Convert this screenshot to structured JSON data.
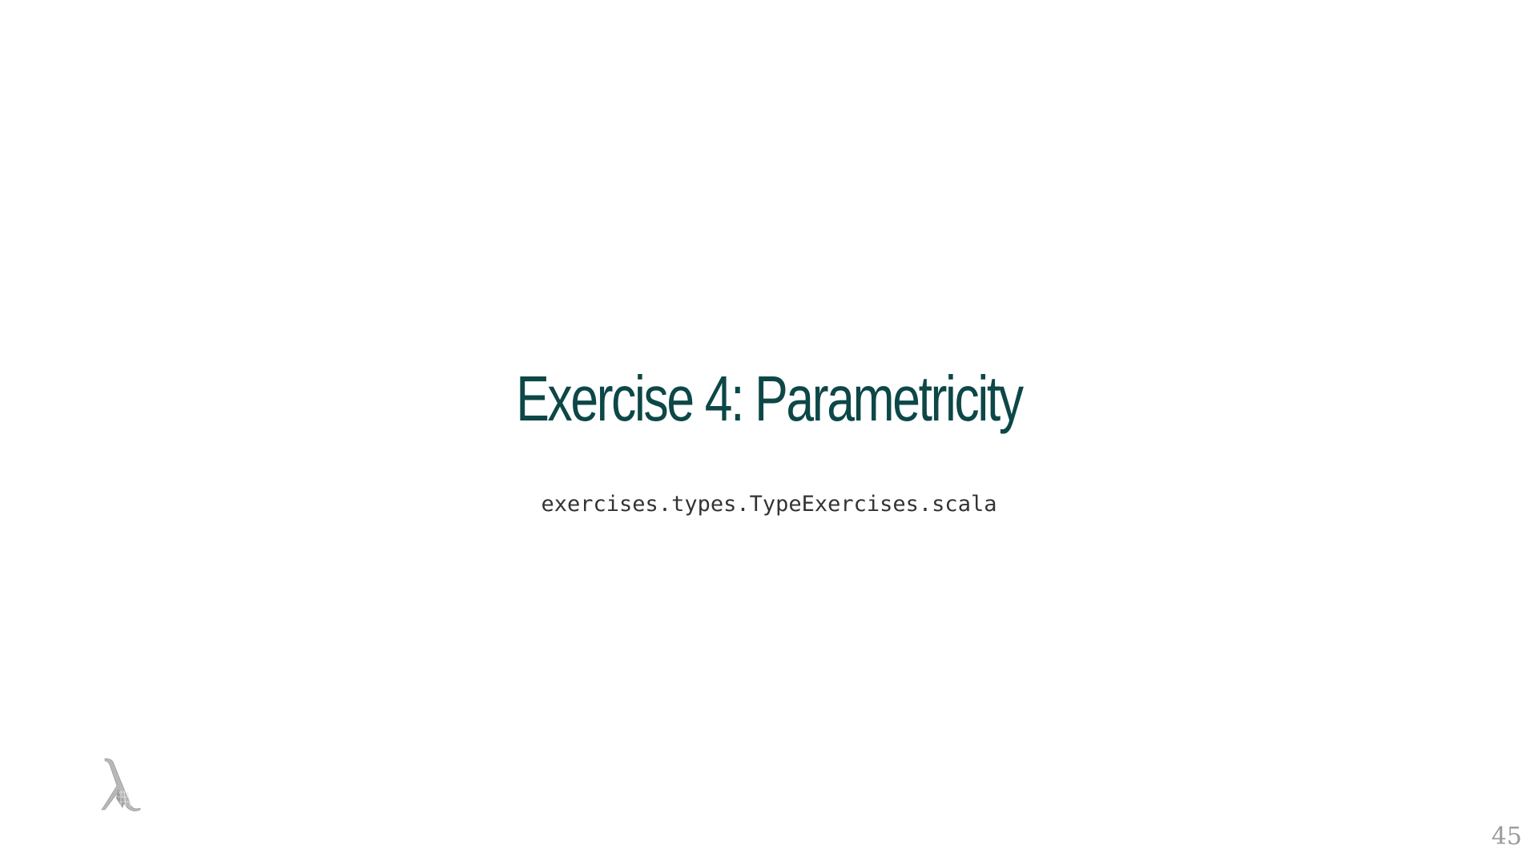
{
  "slide": {
    "title": "Exercise 4: Parametricity",
    "subtitle": "exercises.types.TypeExercises.scala",
    "page_number": "45",
    "logo_icon": "lambda-logo-icon",
    "colors": {
      "title": "#0d4747",
      "subtitle": "#333333",
      "page_number": "#9a9a9a",
      "background": "#ffffff"
    }
  }
}
